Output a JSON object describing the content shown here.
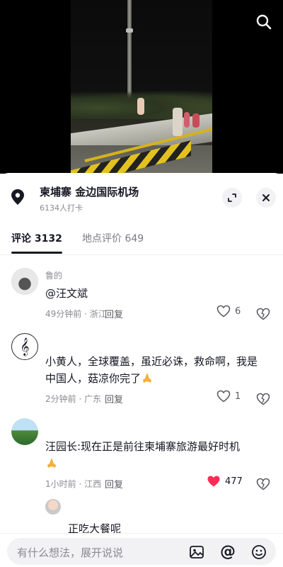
{
  "video": {
    "search_icon": "search-icon"
  },
  "location": {
    "name": "柬埔寨  金边国际机场",
    "checkins": "6134人打卡",
    "icons": [
      "location-pin-icon",
      "expand-icon",
      "close-icon"
    ]
  },
  "tabs": [
    {
      "label": "评论 3132",
      "active": true
    },
    {
      "label": "地点评价 649",
      "active": false
    }
  ],
  "comments": [
    {
      "user": "鲁的",
      "text": "@汪文斌",
      "time": "49分钟前",
      "region": "浙江",
      "reply_label": "回复",
      "likes": "6",
      "liked": false
    },
    {
      "user": "",
      "text": "小黄人，全球覆盖，虽近必诛，救命啊，我是中国人，菇凉你完了",
      "time": "2分钟前",
      "region": "广东",
      "reply_label": "回复",
      "likes": "1",
      "liked": false
    },
    {
      "user": "",
      "text": "汪园长:现在正是前往柬埔寨旅游最好时机",
      "time": "1小时前",
      "region": "江西",
      "reply_label": "回复",
      "likes": "477",
      "liked": true
    }
  ],
  "reply": {
    "user": "",
    "text": "正吃大餐呢"
  },
  "input": {
    "placeholder": "有什么想法，展开说说",
    "at_symbol": "@"
  },
  "colors": {
    "accent_like": "#fe2c55",
    "text_primary": "#161823",
    "text_secondary": "#8a8b91"
  }
}
